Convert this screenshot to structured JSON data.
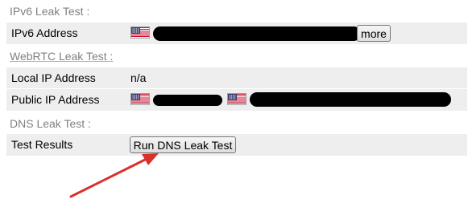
{
  "ipv6_section": {
    "title": "IPv6 Leak Test :",
    "address_label": "IPv6 Address",
    "address_flag": "us-flag-icon",
    "more_button": "more"
  },
  "webrtc_section": {
    "title": "WebRTC Leak Test :",
    "local_label": "Local IP Address",
    "local_value": "n/a",
    "public_label": "Public IP Address",
    "public_flags": [
      "us-flag-icon",
      "us-flag-icon"
    ]
  },
  "dns_section": {
    "title": "DNS Leak Test :",
    "results_label": "Test Results",
    "run_button": "Run DNS Leak Test"
  },
  "colors": {
    "row_background": "#eeeeee",
    "section_title": "#808080",
    "annotation_arrow": "#d9302c",
    "redaction": "#000000"
  }
}
